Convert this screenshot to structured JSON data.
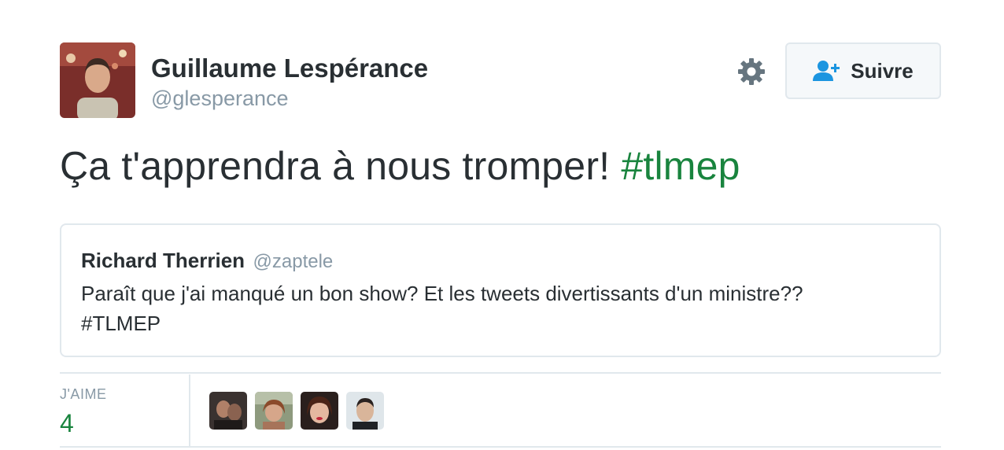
{
  "author": {
    "name": "Guillaume Lespérance",
    "handle": "@glesperance",
    "avatar_icon": "user-avatar-photo"
  },
  "actions": {
    "settings_icon": "gear-icon",
    "follow_icon": "person-plus-icon",
    "follow_label": "Suivre"
  },
  "tweet": {
    "text": "Ça t'apprendra à nous tromper! ",
    "hashtag": "#tlmep"
  },
  "quoted_tweet": {
    "name": "Richard Therrien",
    "handle": "@zaptele",
    "text_line1": "Paraît que j'ai manqué un bon show? Et les tweets divertissants d'un ministre??",
    "text_line2": "#TLMEP"
  },
  "stats": {
    "likes_label": "J'AIME",
    "likes_count": "4"
  },
  "colors": {
    "accent": "#19843e",
    "text": "#292f33",
    "muted": "#8899a6",
    "border": "#e1e8ed"
  }
}
